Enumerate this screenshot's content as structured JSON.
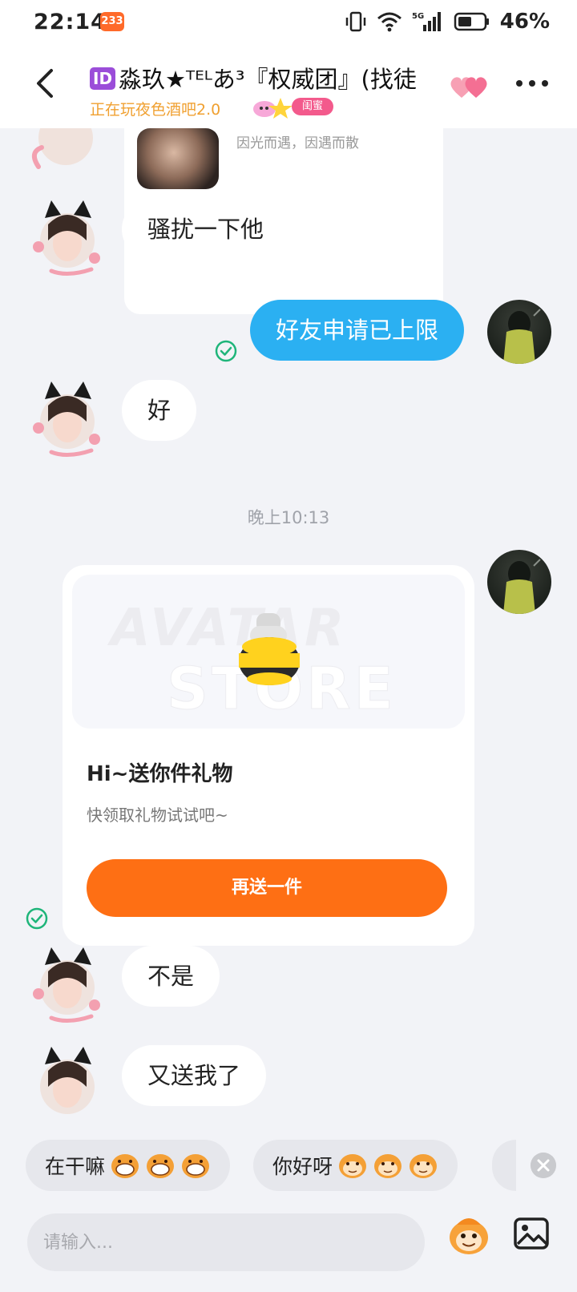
{
  "status_bar": {
    "time": "22:14",
    "notification_badge": "233",
    "network": "5G",
    "battery": "46%"
  },
  "header": {
    "id_badge": "ID",
    "title": "淼玖★ᵀᴱᴸあ³『权威团』(找徒",
    "subtitle": "正在玩夜色酒吧2.0",
    "relation_tag": "闺蜜"
  },
  "messages": {
    "quoted_text": "因光而遇，因遇而散",
    "m1": "骚扰一下他",
    "m2": "好友申请已上限",
    "m3": "好",
    "timestamp": "晚上10:13",
    "m5": "不是",
    "m6": "又送我了"
  },
  "gift_card": {
    "watermark_top": "AVATAR",
    "watermark_bottom": "STORE",
    "title": "Hi~送你件礼物",
    "description": "快领取礼物试试吧~",
    "button_label": "再送一件"
  },
  "quick_replies": [
    {
      "label": "在干嘛"
    },
    {
      "label": "你好呀"
    }
  ],
  "input": {
    "placeholder": "请输入..."
  },
  "colors": {
    "accent_blue": "#2bb0f2",
    "accent_orange": "#fe6f14",
    "check_green": "#1fb57a",
    "id_purple": "#9b4dd9",
    "tag_pink": "#f35a8c",
    "subtitle_gold": "#f0a030"
  },
  "icons": [
    "back-icon",
    "hearts-icon",
    "more-icon",
    "check-icon",
    "close-icon",
    "emoji-icon",
    "image-icon",
    "signal-icon",
    "wifi-icon",
    "battery-icon",
    "vibrate-icon"
  ]
}
